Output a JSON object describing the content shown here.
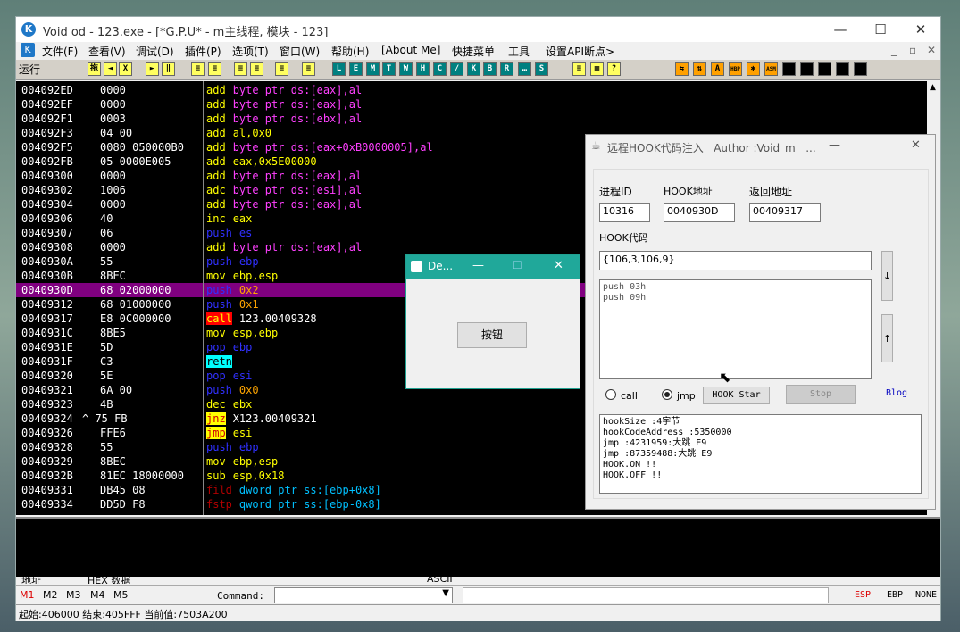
{
  "window": {
    "title": "Void od - 123.exe - [*G.P.U* - m主线程, 模块 - 123]",
    "app_icon": "K",
    "minimize_icon": "—",
    "maximize_icon": "☐",
    "close_icon": "✕"
  },
  "menu": [
    "文件(F)",
    "查看(V)",
    "调试(D)",
    "插件(P)",
    "选项(T)",
    "窗口(W)",
    "帮助(H)",
    "[About Me]",
    "快捷菜单",
    "工具",
    "设置API断点>"
  ],
  "menu_right": [
    "_",
    "▫",
    "✕"
  ],
  "toolbar": {
    "status": "运行",
    "buttons": [
      "拖",
      "◄",
      "X",
      "►",
      "‖",
      "≡",
      "≡",
      "≡",
      "≡",
      "≡",
      "≡",
      "L",
      "E",
      "M",
      "T",
      "W",
      "H",
      "C",
      "/",
      "K",
      "B",
      "R",
      "…",
      "S",
      "≡",
      "▦",
      "?",
      "⇆",
      "⇅",
      "A",
      "HBP",
      "✱",
      "ASM"
    ]
  },
  "disasm": [
    {
      "addr": "004092ED",
      "hex": "0000",
      "m": "add",
      "op": "byte ptr ds:[eax],al"
    },
    {
      "addr": "004092EF",
      "hex": "0000",
      "m": "add",
      "op": "byte ptr ds:[eax],al"
    },
    {
      "addr": "004092F1",
      "hex": "0003",
      "m": "add",
      "op": "byte ptr ds:[ebx],al"
    },
    {
      "addr": "004092F3",
      "hex": "04 00",
      "m": "add",
      "op": "al,0x0"
    },
    {
      "addr": "004092F5",
      "hex": "0080 050000B0",
      "m": "add",
      "op": "byte ptr ds:[eax+0xB0000005],al"
    },
    {
      "addr": "004092FB",
      "hex": "05 0000E005",
      "m": "add",
      "op": "eax,0x5E00000"
    },
    {
      "addr": "00409300",
      "hex": "0000",
      "m": "add",
      "op": "byte ptr ds:[eax],al"
    },
    {
      "addr": "00409302",
      "hex": "1006",
      "m": "adc",
      "op": "byte ptr ds:[esi],al"
    },
    {
      "addr": "00409304",
      "hex": "0000",
      "m": "add",
      "op": "byte ptr ds:[eax],al"
    },
    {
      "addr": "00409306",
      "hex": "40",
      "m": "inc",
      "op": "eax"
    },
    {
      "addr": "00409307",
      "hex": "06",
      "m": "push",
      "op": "es"
    },
    {
      "addr": "00409308",
      "hex": "0000",
      "m": "add",
      "op": "byte ptr ds:[eax],al"
    },
    {
      "addr": "0040930A",
      "hex": "55",
      "m": "push",
      "op": "ebp"
    },
    {
      "addr": "0040930B",
      "hex": "8BEC",
      "m": "mov",
      "op": "ebp,esp"
    },
    {
      "addr": "0040930D",
      "hex": "68 02000000",
      "m": "push",
      "op": "0x2"
    },
    {
      "addr": "00409312",
      "hex": "68 01000000",
      "m": "push",
      "op": "0x1"
    },
    {
      "addr": "00409317",
      "hex": "E8 0C000000",
      "m": "call",
      "op": "123.00409328"
    },
    {
      "addr": "0040931C",
      "hex": "8BE5",
      "m": "mov",
      "op": "esp,ebp"
    },
    {
      "addr": "0040931E",
      "hex": "5D",
      "m": "pop",
      "op": "ebp"
    },
    {
      "addr": "0040931F",
      "hex": "C3",
      "m": "retn",
      "op": ""
    },
    {
      "addr": "00409320",
      "hex": "5E",
      "m": "pop",
      "op": "esi"
    },
    {
      "addr": "00409321",
      "hex": "6A 00",
      "m": "push",
      "op": "0x0"
    },
    {
      "addr": "00409323",
      "hex": "4B",
      "m": "dec",
      "op": "ebx"
    },
    {
      "addr": "00409324",
      "hex": "^ 75 FB",
      "m": "jnz",
      "op": "X123.00409321"
    },
    {
      "addr": "00409326",
      "hex": "FFE6",
      "m": "jmp",
      "op": "esi"
    },
    {
      "addr": "00409328",
      "hex": "55",
      "m": "push",
      "op": "ebp"
    },
    {
      "addr": "00409329",
      "hex": "8BEC",
      "m": "mov",
      "op": "ebp,esp"
    },
    {
      "addr": "0040932B",
      "hex": "81EC 18000000",
      "m": "sub",
      "op": "esp,0x18"
    },
    {
      "addr": "00409331",
      "hex": "DB45 08",
      "m": "fild",
      "op": "dword ptr ss:[ebp+0x8]"
    },
    {
      "addr": "00409334",
      "hex": "DD5D F8",
      "m": "fstp",
      "op": "qword ptr ss:[ebp-0x8]"
    }
  ],
  "selected_row": 14,
  "dump_header": [
    "地址",
    "HEX 数据",
    "ASCII"
  ],
  "cmdbar": {
    "tabs": [
      "M1",
      "M2",
      "M3",
      "M4",
      "M5"
    ],
    "command_label": "Command:",
    "regs": [
      "ESP",
      "EBP",
      "NONE"
    ]
  },
  "status": "起始:406000 结束:405FFF 当前值:7503A200",
  "de_dialog": {
    "title": "De...",
    "button": "按钮",
    "minimize": "—",
    "maximize": "☐",
    "close": "✕"
  },
  "hook": {
    "title": "远程HOOK代码注入   Author :Void_m   ...",
    "minimize": "—",
    "close": "✕",
    "pid_label": "进程ID",
    "pid": "10316",
    "addr_label": "HOOK地址",
    "addr": "0040930D",
    "ret_label": "返回地址",
    "ret": "00409317",
    "code_label": "HOOK代码",
    "code_input": "{106,3,106,9}",
    "code_lines": [
      "push 03h",
      "push 09h"
    ],
    "down_btn": "↓",
    "up_btn": "↑",
    "radio_call": "call",
    "radio_jmp": "jmp",
    "start_btn": "HOOK Star",
    "stop_btn": "Stop",
    "blog": "Blog",
    "log": [
      "hookSize :4字节",
      "hookCodeAddress :5350000",
      "jmp :4231959:大跳 E9",
      "jmp :87359488:大跳 E9",
      "HOOK.ON !!",
      "HOOK.OFF !!"
    ]
  },
  "colors": {
    "mnemonic": "#ffff00",
    "push": "#3030ff",
    "operand_add": "#ff40ff",
    "sel_bg": "#800080",
    "call_bg": "#ff0000",
    "retn_bg": "#00ffff",
    "jmp_bg": "#ffff00",
    "fpu": "#b00000",
    "number": "#ffa500"
  }
}
